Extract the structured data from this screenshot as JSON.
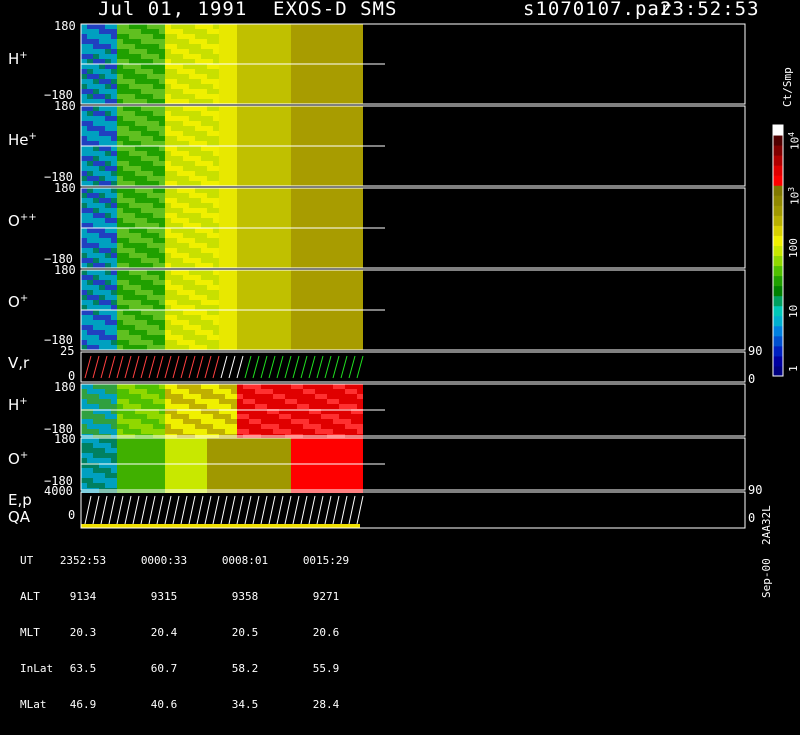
{
  "header": {
    "date": "Jul 01, 1991",
    "instrument": "EXOS-D SMS",
    "file": "s1070107.par",
    "time": "23:52:53"
  },
  "colorbar": {
    "title": "Ct/Smp",
    "tick_labels": [
      "1",
      "10",
      "100",
      "10",
      "10"
    ],
    "tick_exps": [
      "",
      "",
      "",
      "3",
      "4"
    ],
    "colors": [
      "#000080",
      "#0000a0",
      "#0020c0",
      "#0050d0",
      "#0080e0",
      "#00b0d0",
      "#00c8b8",
      "#00a060",
      "#008000",
      "#20a000",
      "#50c000",
      "#90d800",
      "#c8e800",
      "#f0f000",
      "#d8d000",
      "#b8b000",
      "#a09800",
      "#908800",
      "#807800",
      "#ff0000",
      "#e00000",
      "#b00000",
      "#800000",
      "#500000",
      "#ffffff"
    ]
  },
  "panels": [
    {
      "label_base": "H",
      "label_sup": "+",
      "ymax": "180",
      "ymin": "−180"
    },
    {
      "label_base": "He",
      "label_sup": "+",
      "ymax": "180",
      "ymin": "−180"
    },
    {
      "label_base": "O",
      "label_sup": "++",
      "ymax": "180",
      "ymin": "−180"
    },
    {
      "label_base": "O",
      "label_sup": "+",
      "ymax": "180",
      "ymin": "−180"
    },
    {
      "label_base": "V,r",
      "label_sup": "",
      "ymax": "25",
      "ymin": "0",
      "right_top": "90",
      "right_bottom": "0"
    },
    {
      "label_base": "H",
      "label_sup": "+",
      "ymax": "180",
      "ymin": "−180"
    },
    {
      "label_base": "O",
      "label_sup": "+",
      "ymax": "180",
      "ymin": "−180"
    },
    {
      "label_base": "E,p",
      "label_sup": "",
      "label2": "QA",
      "ymax": "4000",
      "ymin": "0",
      "right_top": "90",
      "right_bottom": "0"
    }
  ],
  "table": {
    "row_labels": [
      "UT",
      "ALT",
      "MLT",
      "InLat",
      "MLat"
    ],
    "columns": [
      [
        "2352:53",
        "9134",
        "20.3",
        "63.5",
        "46.9"
      ],
      [
        "0000:33",
        "9315",
        "20.4",
        "60.7",
        "40.6"
      ],
      [
        "0008:01",
        "9358",
        "20.5",
        "58.2",
        "34.5"
      ],
      [
        "0015:29",
        "9271",
        "20.6",
        "55.9",
        "28.4"
      ]
    ]
  },
  "footer": {
    "code": "Sep-00  2AA32L"
  }
}
